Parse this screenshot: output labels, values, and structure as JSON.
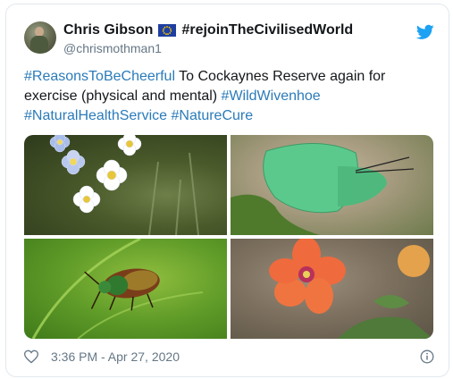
{
  "author": {
    "display_name": "Chris Gibson",
    "display_name_suffix": "#rejoinTheCivilisedWorld",
    "handle": "@chrismothman1",
    "flag_emoji": "eu-flag"
  },
  "tweet": {
    "text_parts": [
      {
        "text": "#ReasonsToBeCheerful",
        "hashtag": true
      },
      {
        "text": " To Cockaynes Reserve again for exercise (physical and mental) ",
        "hashtag": false
      },
      {
        "text": "#WildWivenhoe",
        "hashtag": true
      },
      {
        "text": " ",
        "hashtag": false
      },
      {
        "text": "#NaturalHealthService",
        "hashtag": true
      },
      {
        "text": " ",
        "hashtag": false
      },
      {
        "text": "#NatureCure",
        "hashtag": true
      }
    ]
  },
  "media": {
    "photos": [
      {
        "subject": "forget-me-not flowers"
      },
      {
        "subject": "green hairstreak butterfly"
      },
      {
        "subject": "metallic leaf beetle on leaf"
      },
      {
        "subject": "scarlet pimpernel flower"
      }
    ]
  },
  "footer": {
    "timestamp": "3:36 PM - Apr 27, 2020"
  },
  "icons": {
    "like": "heart-icon",
    "info": "info-icon",
    "brand": "twitter-logo-icon"
  },
  "colors": {
    "hashtag": "#2b7bb9",
    "twitter_blue": "#1da1f2",
    "secondary_text": "#657786"
  }
}
